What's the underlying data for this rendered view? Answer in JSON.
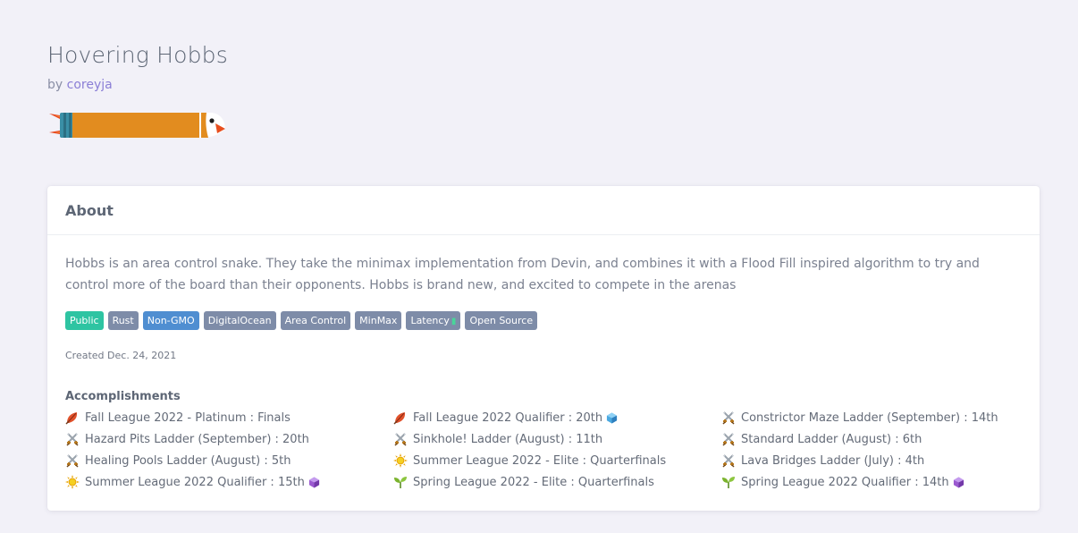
{
  "snake": {
    "name": "Hovering Hobbs",
    "by_prefix": "by",
    "author": "coreyja"
  },
  "about": {
    "title": "About",
    "description": "Hobbs is an area control snake. They take the minimax implementation from Devin, and combines it with a Flood Fill inspired algorithm to try and control more of the board than their opponents. Hobbs is brand new, and excited to compete in the arenas",
    "tags": [
      "Public",
      "Rust",
      "Non-GMO",
      "DigitalOcean",
      "Area Control",
      "MinMax",
      "Latency",
      "Open Source"
    ],
    "created": "Created Dec. 24, 2021"
  },
  "accomplishments": {
    "title": "Accomplishments",
    "items": [
      {
        "icon": "autumn-leaf-icon",
        "text": "Fall League 2022 - Platinum : Finals",
        "gem": ""
      },
      {
        "icon": "autumn-leaf-icon",
        "text": "Fall League 2022 Qualifier : 20th",
        "gem": "blue-gem-icon"
      },
      {
        "icon": "crossed-swords-icon",
        "text": "Constrictor Maze Ladder (September) : 14th",
        "gem": ""
      },
      {
        "icon": "crossed-swords-icon",
        "text": "Hazard Pits Ladder (September) : 20th",
        "gem": ""
      },
      {
        "icon": "crossed-swords-icon",
        "text": "Sinkhole! Ladder (August) : 11th",
        "gem": ""
      },
      {
        "icon": "crossed-swords-icon",
        "text": "Standard Ladder (August) : 6th",
        "gem": ""
      },
      {
        "icon": "crossed-swords-icon",
        "text": "Healing Pools Ladder (August) : 5th",
        "gem": ""
      },
      {
        "icon": "sun-icon",
        "text": "Summer League 2022 - Elite : Quarterfinals",
        "gem": ""
      },
      {
        "icon": "crossed-swords-icon",
        "text": "Lava Bridges Ladder (July) : 4th",
        "gem": ""
      },
      {
        "icon": "sun-icon",
        "text": "Summer League 2022 Qualifier : 15th",
        "gem": "purple-gem-icon"
      },
      {
        "icon": "seedling-icon",
        "text": "Spring League 2022 - Elite : Quarterfinals",
        "gem": ""
      },
      {
        "icon": "seedling-icon",
        "text": "Spring League 2022 Qualifier : 14th",
        "gem": "purple-gem-icon"
      }
    ]
  },
  "colors": {
    "background": "#f2f1f8",
    "author_link": "#8b7fd6",
    "tag_default": "#7e8ca8",
    "tag_public": "#2ec4a2",
    "tag_nongmo": "#4f8ed1",
    "snake_body": "#e28c1f",
    "snake_tail": "#3a8fa6"
  }
}
